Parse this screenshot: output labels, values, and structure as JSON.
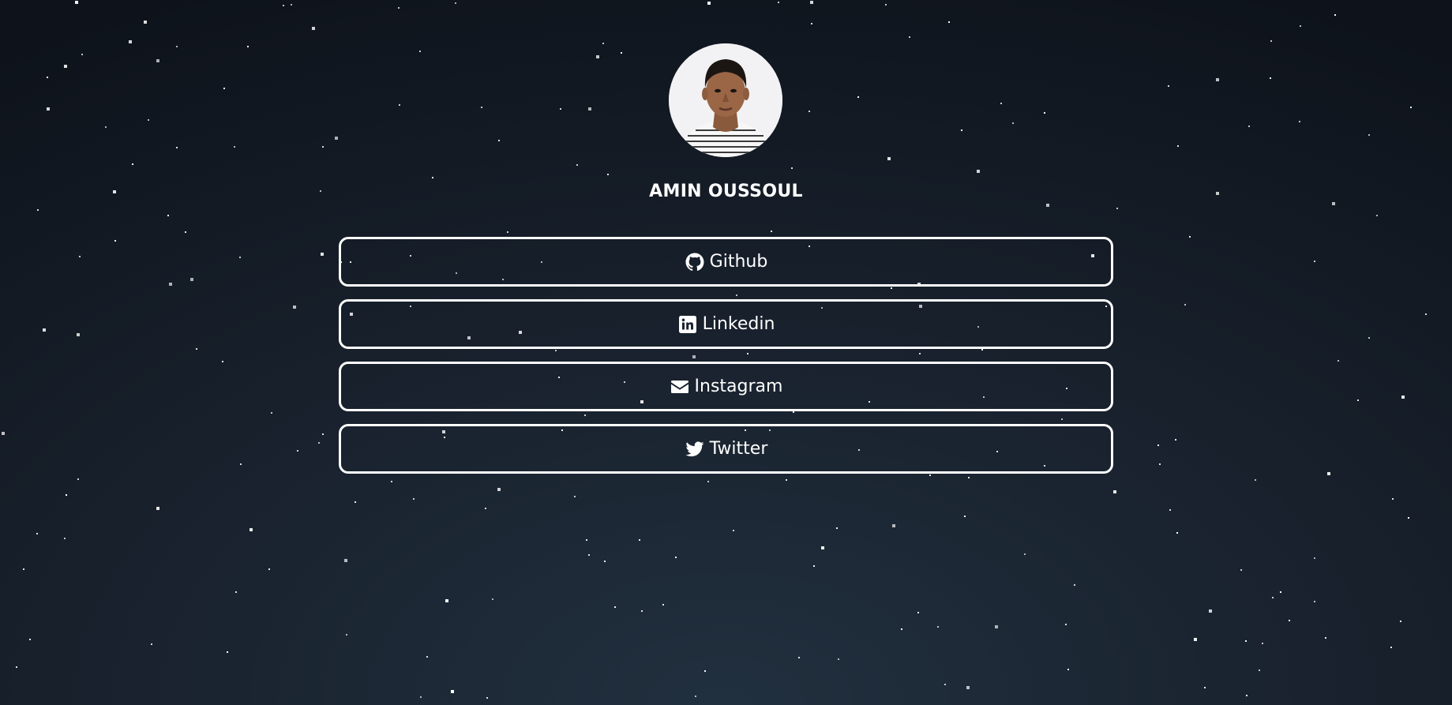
{
  "profile": {
    "name": "AMIN OUSSOUL",
    "avatar": "avatar-photo"
  },
  "links": [
    {
      "label": "Github",
      "icon": "github-icon"
    },
    {
      "label": "Linkedin",
      "icon": "linkedin-icon"
    },
    {
      "label": "Instagram",
      "icon": "envelope-icon"
    },
    {
      "label": "Twitter",
      "icon": "twitter-icon"
    }
  ],
  "colors": {
    "background_top": "#0e131b",
    "background_bottom": "#21303f",
    "foreground": "#ffffff"
  }
}
